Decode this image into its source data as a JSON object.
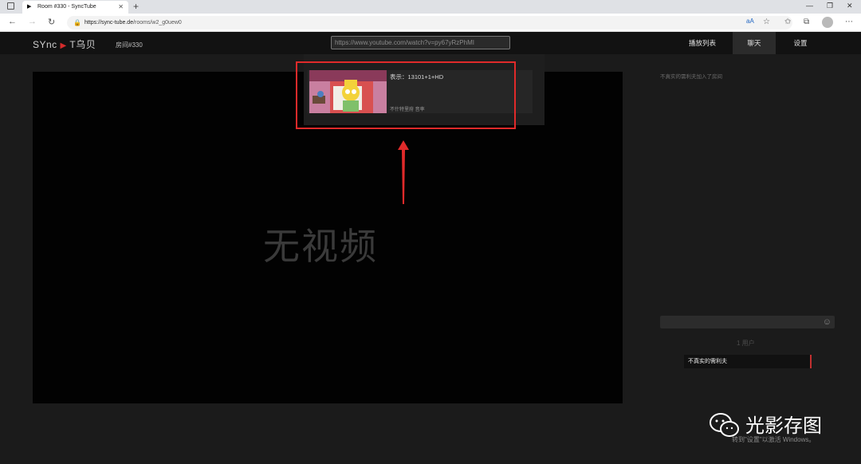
{
  "browser": {
    "tab_title": "Room #330 - SyncTube",
    "url_host": "https://sync-tube.de",
    "url_path": "/rooms/w2_g0uew0"
  },
  "app": {
    "logo_left": "SYnc",
    "logo_right": "T乌贝",
    "room_label": "房间#330",
    "search_value": "https://www.youtube.com/watch?v=py67yRzPhMI",
    "nav": {
      "playlist": "播放列表",
      "chat": "聊天",
      "settings": "设置"
    }
  },
  "player": {
    "no_video_text": "无视频"
  },
  "search_result": {
    "title": "表示：13101+1+HD",
    "description": "不什特里府 音率"
  },
  "chat": {
    "join_message": "不真实的需利夫加入了房间",
    "user_count": "1 用户",
    "users": [
      "不真实的需利夫"
    ]
  },
  "watermark": {
    "brand": "光影存图",
    "activation": "转到\"设置\"以激活 Windows。"
  }
}
